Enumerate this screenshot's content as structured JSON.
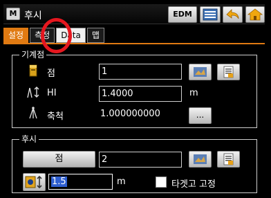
{
  "window": {
    "app_icon": "M",
    "title": "후시",
    "edm_label": "EDM"
  },
  "tabs": [
    {
      "label": "설정"
    },
    {
      "label": "측정"
    },
    {
      "label": "Data"
    },
    {
      "label": "맵"
    }
  ],
  "base_group": {
    "title": "기계점",
    "point_label": "점",
    "point_value": "1",
    "hi_label": "HI",
    "hi_value": "1.4000",
    "hi_unit": "m",
    "scale_label": "축척",
    "scale_value": "1.000000000",
    "dots_label": "..."
  },
  "backsight_group": {
    "title": "후시",
    "point_button_label": "점",
    "point_value": "2",
    "height_value": "1.5",
    "height_unit": "m",
    "target_fixed_label": "타겟고 고정",
    "target_fixed_checked": false
  },
  "colors": {
    "accent": "#e07a12",
    "highlight_circle": "#e5171f"
  }
}
